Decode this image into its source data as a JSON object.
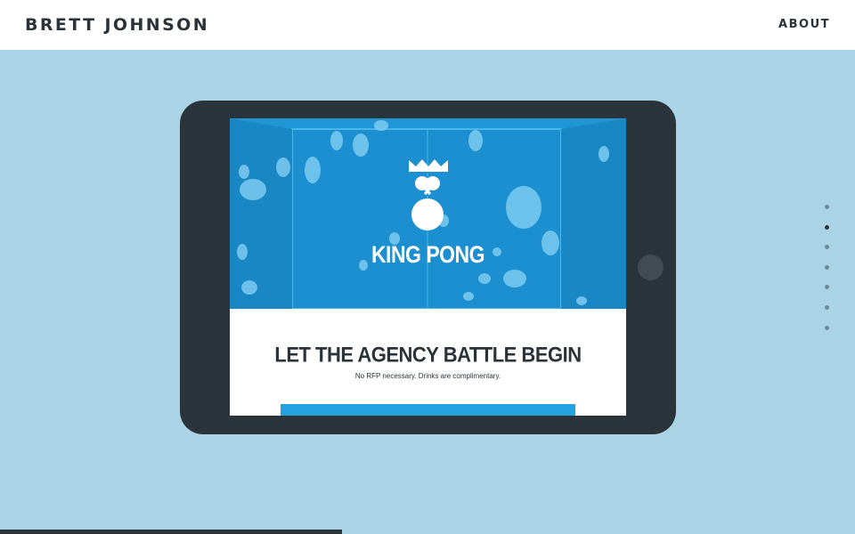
{
  "header": {
    "brand": "BRETT JOHNSON",
    "nav_about": "ABOUT"
  },
  "project": {
    "logo_text": "KING PONG",
    "headline": "LET THE AGENCY BATTLE BEGIN",
    "subline": "No RFP necessary. Drinks are complimentary."
  },
  "pager": {
    "count": 7,
    "active_index": 1
  },
  "scroll_progress_fraction": 0.4,
  "colors": {
    "background": "#aad4e6",
    "device": "#2b343b",
    "hero_blue": "#1f97d7",
    "accent": "#22a3e0"
  },
  "icons": [
    "crown-icon",
    "ping-pong-paddles-icon",
    "ball-icon"
  ]
}
